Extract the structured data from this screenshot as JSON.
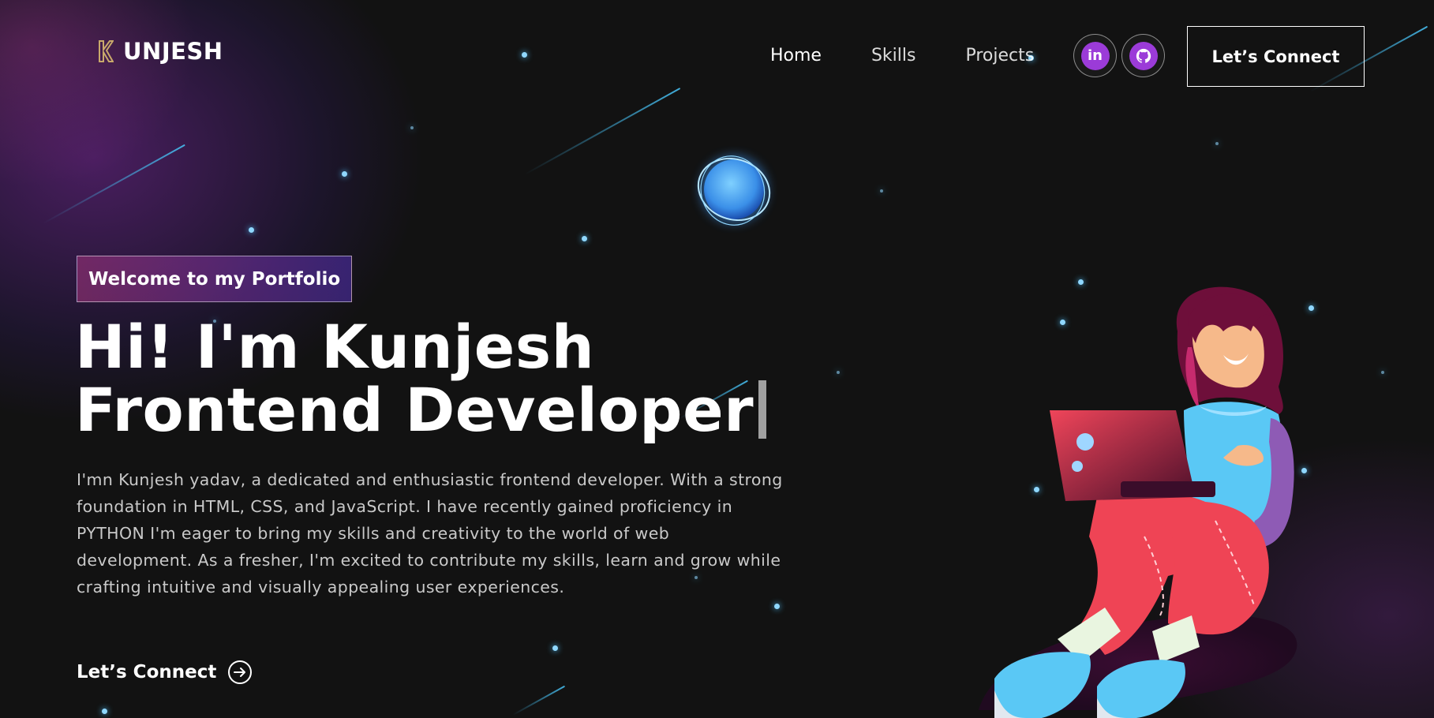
{
  "brand": {
    "logo_text": "UNJESH"
  },
  "nav": {
    "links": [
      {
        "label": "Home"
      },
      {
        "label": "Skills"
      },
      {
        "label": "Projects"
      }
    ],
    "social": [
      {
        "icon": "linkedin-icon",
        "glyph": "in"
      },
      {
        "icon": "github-icon",
        "glyph": ""
      }
    ],
    "connect_label": "Let’s Connect"
  },
  "hero": {
    "tagline": "Welcome to my Portfolio",
    "title_line1": "Hi! I'm Kunjesh",
    "title_line2": "Frontend Developer",
    "description": "I'mn Kunjesh yadav, a dedicated and enthusiastic frontend developer. With a strong foundation in HTML, CSS, and JavaScript. I have recently gained proficiency in PYTHON I'm eager to bring my skills and creativity to the world of web development. As a fresher, I'm excited to contribute my skills, learn and grow while crafting intuitive and visually appealing user experiences.",
    "cta_label": "Let’s Connect"
  },
  "colors": {
    "background": "#121212",
    "accent_purple": "#9b3bd8",
    "tagline_gradient_start": "#aa367c",
    "tagline_gradient_end": "#4a2fbd",
    "star_blue": "#8fd7ff"
  }
}
